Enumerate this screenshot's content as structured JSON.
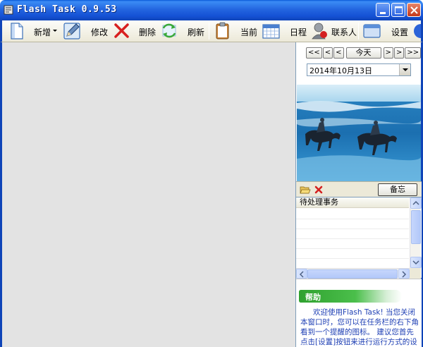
{
  "window": {
    "title": "Flash Task 0.9.53"
  },
  "toolbar": {
    "new_label": "新增",
    "edit_label": "修改",
    "delete_label": "删除",
    "refresh_label": "刷新",
    "current_label": "当前",
    "schedule_label": "日程",
    "contacts_label": "联系人",
    "settings_label": "设置"
  },
  "calendar": {
    "prev_year": "<<",
    "prev_month": "<",
    "prev_day": "<",
    "today": "今天",
    "next_day": ">",
    "next_month": ">",
    "next_year": ">>",
    "selected_date": "2014年10月13日"
  },
  "photo_toolbar": {
    "memo_label": "备忘"
  },
  "todo": {
    "header": "待处理事务"
  },
  "help": {
    "title": "帮助",
    "text": "欢迎使用Flash Task! 当您关闭本窗口时，您可以在任务栏的右下角看到一个提醒的图标。 建议您首先点击[设置]按钮来进行运行方式的设置"
  },
  "colors": {
    "titlebar": "#2466e0",
    "help_tab": "#3cb33c",
    "help_text": "#1e3fb4"
  }
}
